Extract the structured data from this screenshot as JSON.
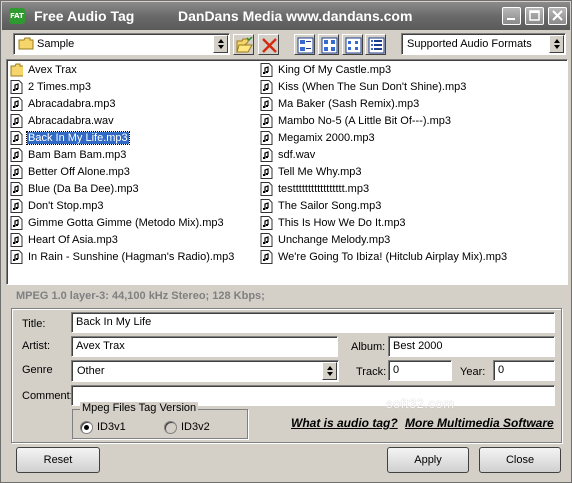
{
  "window": {
    "title": "Free Audio Tag",
    "site": "DanDans Media www.dandans.com",
    "icon_text": "FAT"
  },
  "toolbar": {
    "folder_value": "Sample",
    "filter_value": "Supported Audio Formats",
    "icons": [
      "open-folder-icon",
      "delete-icon",
      "large-icons-view-icon",
      "small-icons-view-icon",
      "list-view-icon",
      "details-view-icon"
    ]
  },
  "files": {
    "left": [
      {
        "name": "Avex Trax",
        "type": "folder"
      },
      {
        "name": "2 Times.mp3",
        "type": "audio"
      },
      {
        "name": "Abracadabra.mp3",
        "type": "audio"
      },
      {
        "name": "Abracadabra.wav",
        "type": "audio"
      },
      {
        "name": "Back In My Life.mp3",
        "type": "audio",
        "selected": true
      },
      {
        "name": "Bam Bam Bam.mp3",
        "type": "audio"
      },
      {
        "name": "Better Off Alone.mp3",
        "type": "audio"
      },
      {
        "name": "Blue (Da Ba Dee).mp3",
        "type": "audio"
      },
      {
        "name": "Don't Stop.mp3",
        "type": "audio"
      },
      {
        "name": "Gimme Gotta Gimme (Metodo Mix).mp3",
        "type": "audio"
      },
      {
        "name": "Heart Of Asia.mp3",
        "type": "audio"
      },
      {
        "name": "In Rain - Sunshine (Hagman's Radio).mp3",
        "type": "audio"
      }
    ],
    "right": [
      {
        "name": "King Of My Castle.mp3",
        "type": "audio"
      },
      {
        "name": "Kiss (When The Sun Don't Shine).mp3",
        "type": "audio"
      },
      {
        "name": "Ma Baker (Sash Remix).mp3",
        "type": "audio"
      },
      {
        "name": "Mambo No-5 (A Little Bit Of---).mp3",
        "type": "audio"
      },
      {
        "name": "Megamix 2000.mp3",
        "type": "audio"
      },
      {
        "name": "sdf.wav",
        "type": "audio"
      },
      {
        "name": "Tell Me Why.mp3",
        "type": "audio"
      },
      {
        "name": "testtttttttttttttttt.mp3",
        "type": "audio"
      },
      {
        "name": "The Sailor Song.mp3",
        "type": "audio"
      },
      {
        "name": "This Is How We Do It.mp3",
        "type": "audio"
      },
      {
        "name": "Unchange Melody.mp3",
        "type": "audio"
      },
      {
        "name": "We're Going To Ibiza! (Hitclub Airplay Mix).mp3",
        "type": "audio"
      }
    ]
  },
  "info": "MPEG 1.0 layer-3: 44,100 kHz Stereo;  128 Kbps;",
  "tag": {
    "title_label": "Title:",
    "title_value": "Back In My Life",
    "artist_label": "Artist:",
    "artist_value": "Avex Trax",
    "album_label": "Album:",
    "album_value": "Best 2000",
    "genre_label": "Genre",
    "genre_value": "Other",
    "track_label": "Track:",
    "track_value": "0",
    "year_label": "Year:",
    "year_value": "0",
    "comment_label": "Comment:",
    "comment_value": "",
    "version_legend": "Mpeg Files Tag Version",
    "id3v1_label": "ID3v1",
    "id3v2_label": "ID3v2"
  },
  "links": {
    "what_is": "What is audio tag?",
    "more": "More Multimedia Software"
  },
  "watermark": "soft32.com",
  "buttons": {
    "reset": "Reset",
    "apply": "Apply",
    "close": "Close"
  }
}
